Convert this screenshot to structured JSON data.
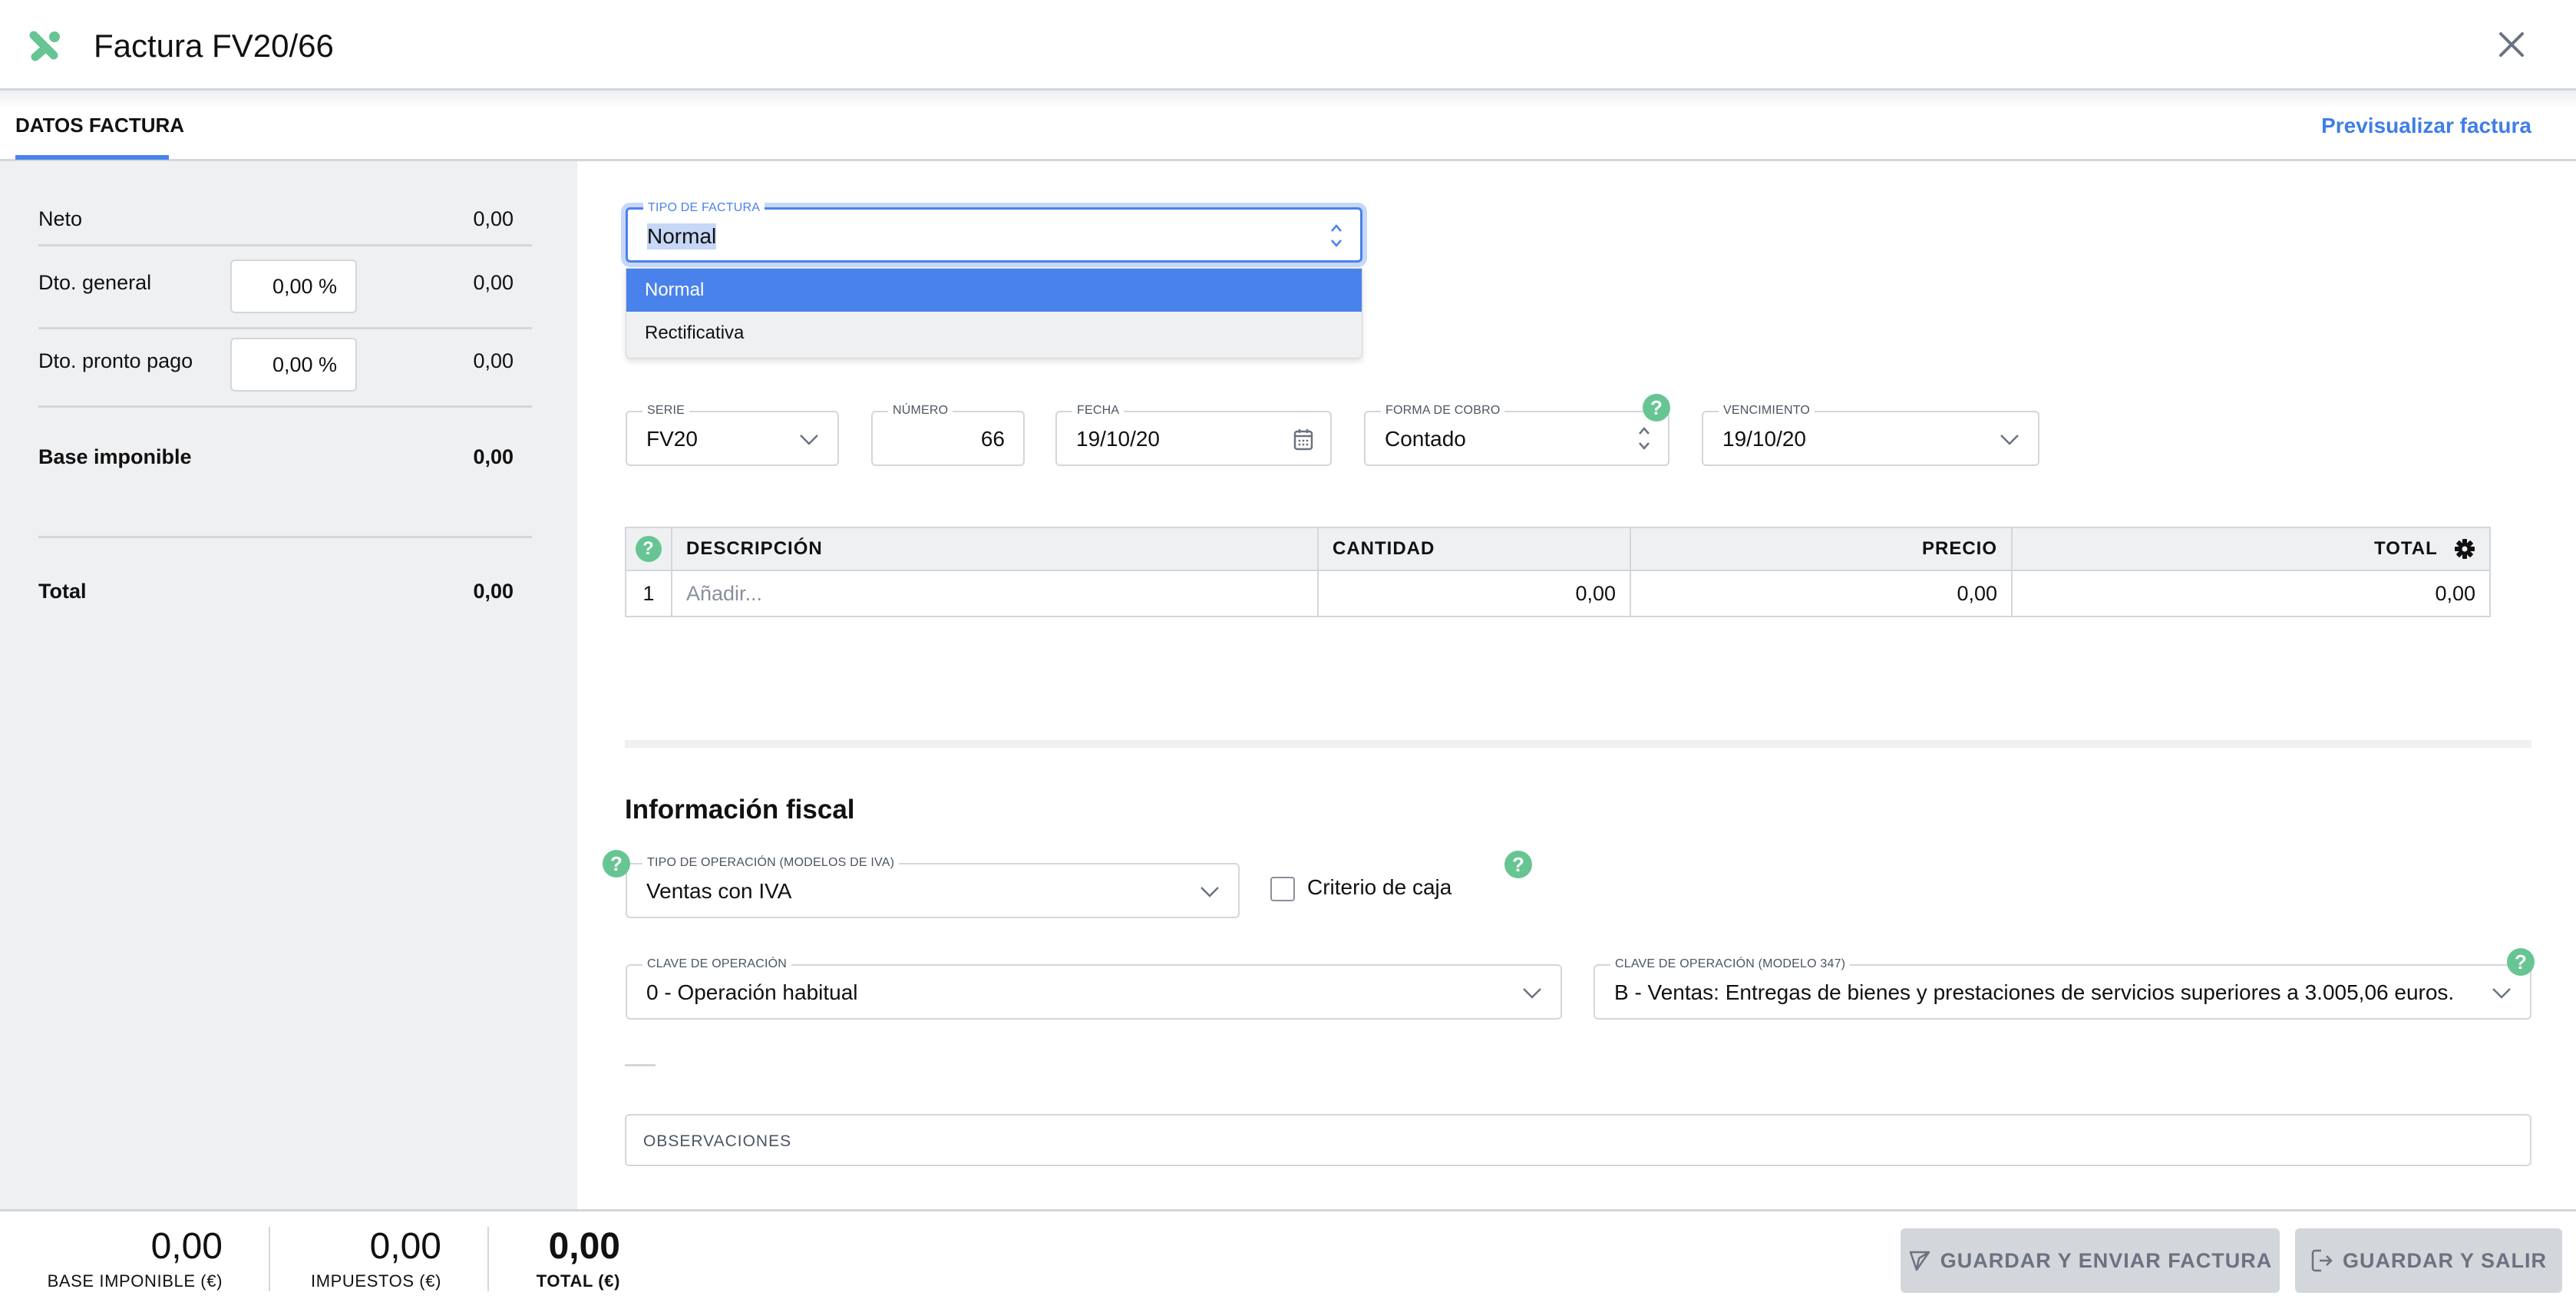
{
  "header": {
    "title": "Factura FV20/66",
    "logo_icon": "app-logo-icon",
    "close_icon": "close-icon"
  },
  "tabs": {
    "active": "DATOS FACTURA",
    "preview_link": "Previsualizar factura"
  },
  "summary": {
    "neto_label": "Neto",
    "neto_value": "0,00",
    "dto_general_label": "Dto. general",
    "dto_general_pct": "0,00 %",
    "dto_general_value": "0,00",
    "dto_pronto_label": "Dto. pronto pago",
    "dto_pronto_pct": "0,00 %",
    "dto_pronto_value": "0,00",
    "base_label": "Base imponible",
    "base_value": "0,00",
    "total_label": "Total",
    "total_value": "0,00"
  },
  "tipo_factura": {
    "label": "TIPO DE FACTURA",
    "value": "Normal",
    "options": [
      "Normal",
      "Rectificativa"
    ],
    "highlighted": "Normal"
  },
  "fields": {
    "serie": {
      "label": "SERIE",
      "value": "FV20"
    },
    "numero": {
      "label": "NÚMERO",
      "value": "66"
    },
    "fecha": {
      "label": "FECHA",
      "value": "19/10/20"
    },
    "forma_cobro": {
      "label": "FORMA DE COBRO",
      "value": "Contado"
    },
    "vencimiento": {
      "label": "VENCIMIENTO",
      "value": "19/10/20"
    }
  },
  "lines": {
    "headers": [
      "DESCRIPCIÓN",
      "CANTIDAD",
      "PRECIO",
      "TOTAL"
    ],
    "rows": [
      {
        "index": "1",
        "descripcion_placeholder": "Añadir...",
        "cantidad": "0,00",
        "precio": "0,00",
        "total": "0,00"
      }
    ]
  },
  "fiscal": {
    "title": "Información fiscal",
    "tipo_operacion": {
      "label": "TIPO DE OPERACIÓN (MODELOS DE IVA)",
      "value": "Ventas con IVA"
    },
    "criterio_caja": {
      "label": "Criterio de caja",
      "checked": false
    },
    "clave_operacion": {
      "label": "CLAVE DE OPERACIÓN",
      "value": "0 - Operación habitual"
    },
    "clave_347": {
      "label": "CLAVE DE OPERACIÓN (MODELO 347)",
      "value": "B - Ventas: Entregas de bienes y prestaciones de servicios superiores a 3.005,06 euros."
    },
    "observaciones_label": "OBSERVACIONES"
  },
  "help_glyph": "?",
  "footer": {
    "base_value": "0,00",
    "base_label": "BASE IMPONIBLE (€)",
    "impuestos_value": "0,00",
    "impuestos_label": "IMPUESTOS (€)",
    "total_value": "0,00",
    "total_label": "TOTAL (€)",
    "send_button": "GUARDAR Y ENVIAR FACTURA",
    "save_exit_button": "GUARDAR Y SALIR"
  },
  "colors": {
    "accent": "#4a82ec",
    "help_green": "#67c593",
    "panel_bg": "#eff0f2",
    "disabled_button": "#d3d6db"
  }
}
